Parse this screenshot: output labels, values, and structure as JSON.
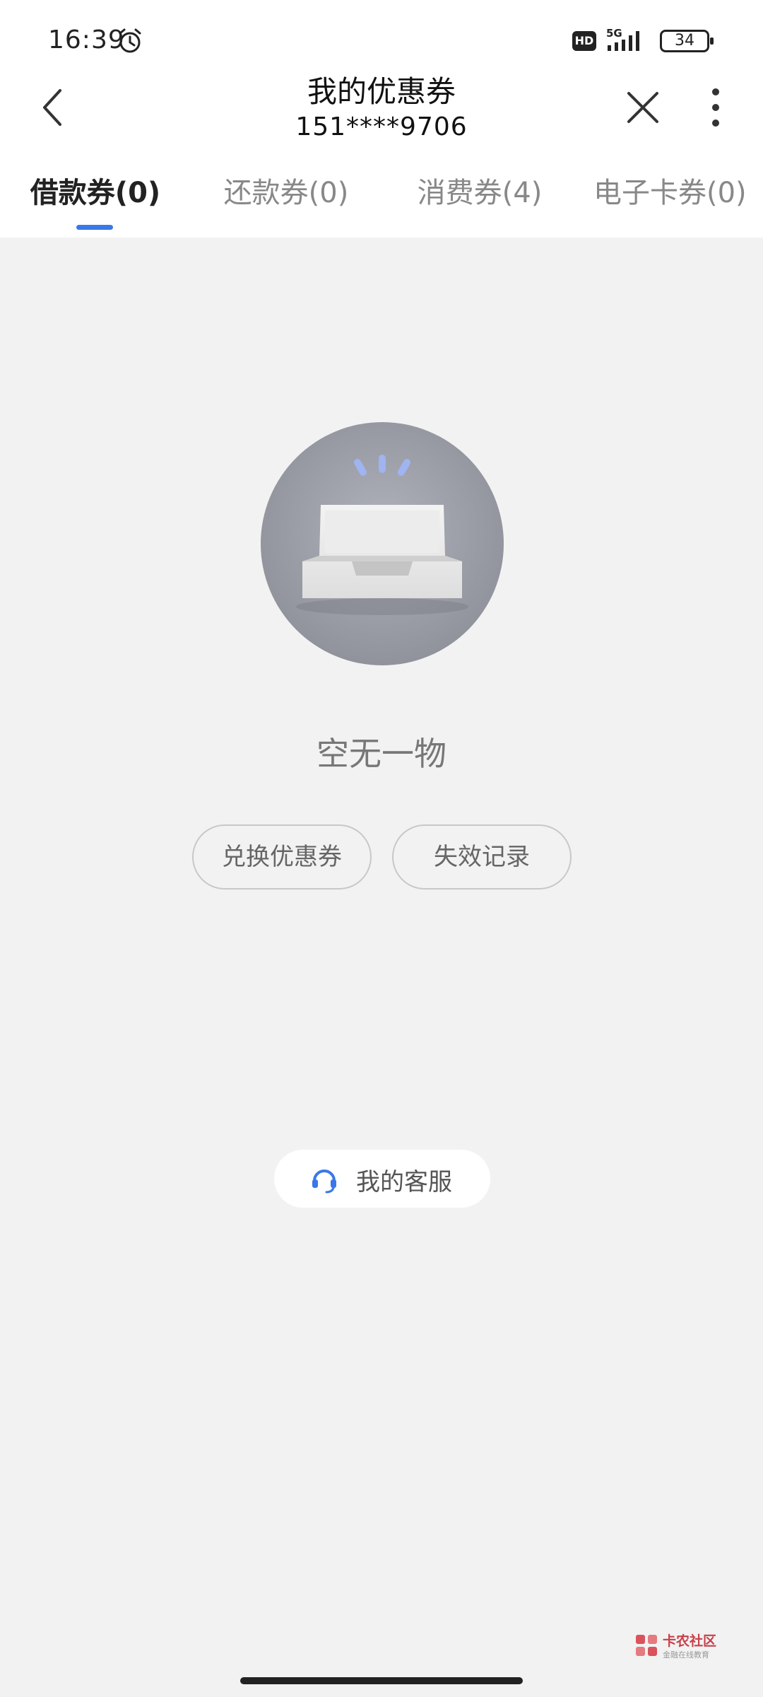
{
  "status_bar": {
    "time": "16:39",
    "hd_label": "HD",
    "network_label": "5G",
    "battery_level": "34",
    "icons": [
      "alarm-icon",
      "signal-icon",
      "battery-icon"
    ]
  },
  "header": {
    "title": "我的优惠券",
    "subtitle": "151****9706",
    "icons": [
      "back-chevron-icon",
      "close-icon",
      "more-vertical-icon"
    ]
  },
  "tabs": [
    {
      "label": "借款券(0)",
      "active": true
    },
    {
      "label": "还款券(0)",
      "active": false
    },
    {
      "label": "消费券(4)",
      "active": false
    },
    {
      "label": "电子卡券(0)",
      "active": false
    }
  ],
  "empty_state": {
    "illustration": "empty-inbox-tray-icon",
    "message": "空无一物",
    "redeem_button": "兑换优惠券",
    "expired_button": "失效记录"
  },
  "customer_service": {
    "label": "我的客服",
    "icon": "headset-icon"
  },
  "watermark": {
    "name": "卡农社区",
    "tagline": "金融在线教育"
  },
  "colors": {
    "accent": "#3a78e8",
    "page_background": "#f2f2f2",
    "surface": "#ffffff",
    "watermark": "#c8414b"
  }
}
